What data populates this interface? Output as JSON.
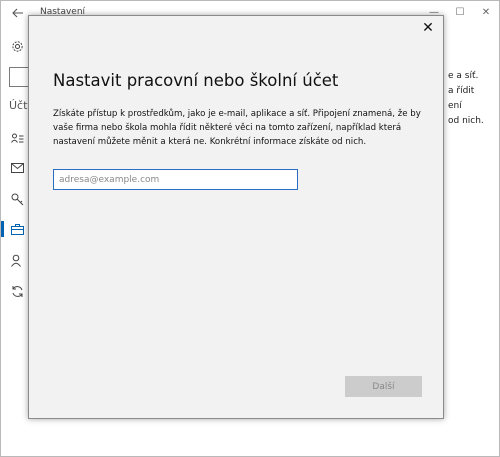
{
  "window": {
    "title": "Nastavení",
    "back_icon": "back-arrow-icon",
    "controls": {
      "minimize": "—",
      "maximize": "☐",
      "close": "✕"
    }
  },
  "sidebar": {
    "heading": "Účty",
    "items": [
      {
        "icon": "gear-icon"
      },
      {
        "icon": "person-list-icon"
      },
      {
        "icon": "mail-icon"
      },
      {
        "icon": "key-icon"
      },
      {
        "icon": "briefcase-icon",
        "active": true
      },
      {
        "icon": "person-add-icon"
      },
      {
        "icon": "sync-icon"
      }
    ],
    "accent_color": "#0063b1"
  },
  "background_text": [
    "e a síť.",
    "a řídit",
    "ení",
    "od nich."
  ],
  "dialog": {
    "close_label": "✕",
    "title": "Nastavit pracovní nebo školní účet",
    "description": "Získáte přístup k prostředkům, jako je e-mail, aplikace a síť. Připojení znamená, že by vaše firma nebo škola mohla řídit některé věci na tomto zařízení, například která nastavení můžete měnit a která ne. Konkrétní informace získáte od nich.",
    "email_field": {
      "value": "",
      "placeholder": "adresa@example.com"
    },
    "next_label": "Další",
    "next_enabled": false
  }
}
